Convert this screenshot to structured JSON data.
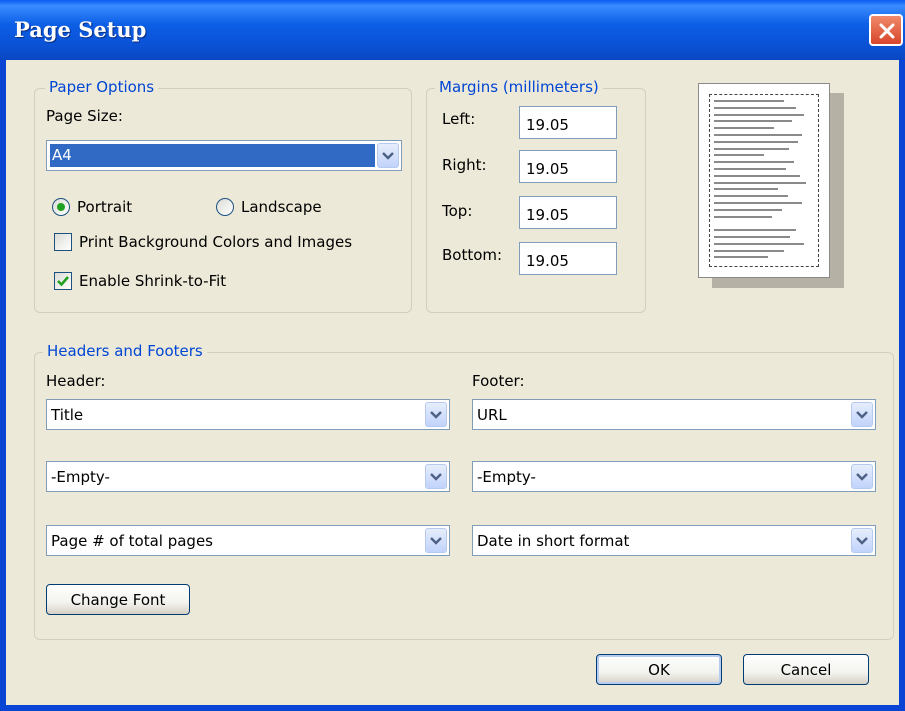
{
  "window": {
    "title": "Page Setup"
  },
  "paper_options": {
    "legend": "Paper Options",
    "page_size_label": "Page Size:",
    "page_size_value": "A4",
    "portrait_label": "Portrait",
    "landscape_label": "Landscape",
    "orientation_selected": "Portrait",
    "print_background_label": "Print Background Colors and Images",
    "print_background_checked": false,
    "shrink_to_fit_label": "Enable Shrink-to-Fit",
    "shrink_to_fit_checked": true
  },
  "margins": {
    "legend": "Margins (millimeters)",
    "left_label": "Left:",
    "left_value": "19.05",
    "right_label": "Right:",
    "right_value": "19.05",
    "top_label": "Top:",
    "top_value": "19.05",
    "bottom_label": "Bottom:",
    "bottom_value": "19.05"
  },
  "headers_footers": {
    "legend": "Headers and Footers",
    "header_label": "Header:",
    "footer_label": "Footer:",
    "header": [
      "Title",
      "-Empty-",
      "Page # of total pages"
    ],
    "footer": [
      "URL",
      "-Empty-",
      "Date in short format"
    ],
    "change_font_label": "Change Font"
  },
  "buttons": {
    "ok_label": "OK",
    "cancel_label": "Cancel"
  },
  "colors": {
    "titlebar": "#0a52d6",
    "legend_text": "#0046d5",
    "dialog_bg": "#ece9d8",
    "selection": "#316ac5"
  }
}
